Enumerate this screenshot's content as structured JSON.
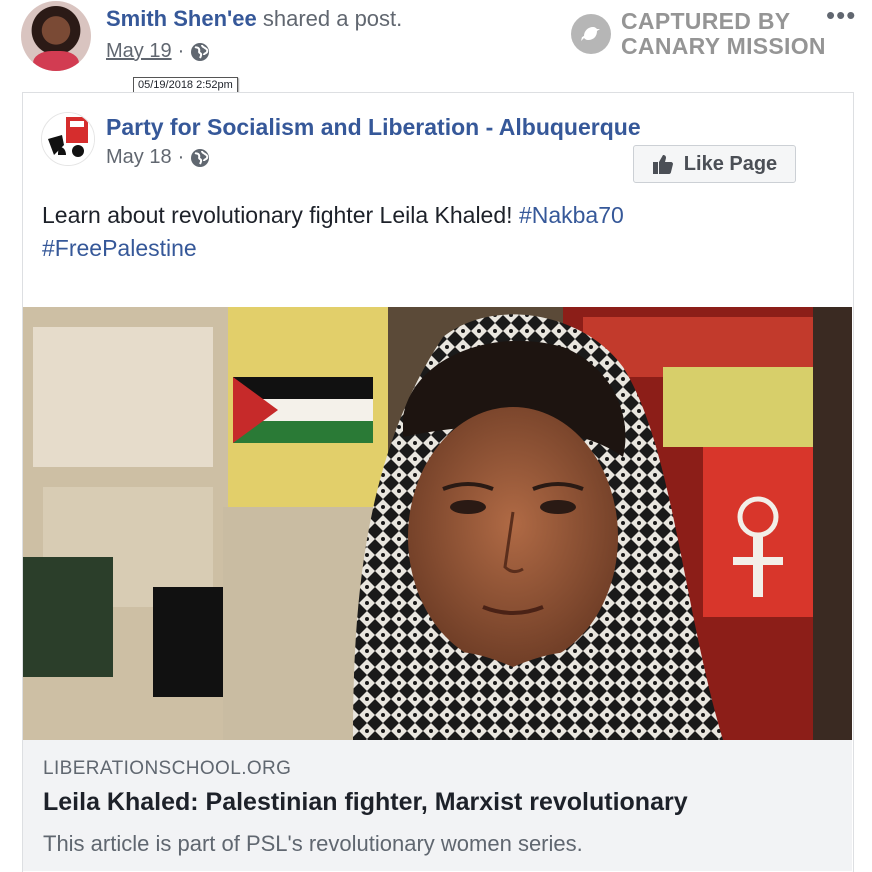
{
  "post_header": {
    "author_name": "Smith Shen'ee",
    "action_text": "shared a post.",
    "date": "May 19",
    "separator": "·",
    "privacy_icon": "globe-icon",
    "timestamp_tooltip": "05/19/2018 2:52pm"
  },
  "watermark": {
    "line1": "CAPTURED BY",
    "line2": "CANARY MISSION",
    "icon": "canary-bird-icon"
  },
  "menu": {
    "icon": "more-options-icon",
    "glyph": "•••"
  },
  "shared_post": {
    "page_name": "Party for Socialism and Liberation - Albuquerque",
    "date": "May 18",
    "separator": "·",
    "privacy_icon": "globe-icon",
    "like_button_label": "Like Page",
    "like_icon": "thumbs-up-icon",
    "text": "Learn about revolutionary fighter Leila Khaled!",
    "hashtags": [
      "#Nakba70",
      "#FreePalestine"
    ]
  },
  "link_preview": {
    "domain": "LIBERATIONSCHOOL.ORG",
    "title": "Leila Khaled: Palestinian fighter, Marxist revolutionary",
    "description": "This article is part of PSL's revolutionary women series."
  },
  "colors": {
    "link_blue": "#365899",
    "meta_gray": "#616770",
    "preview_bg": "#f2f3f5"
  }
}
